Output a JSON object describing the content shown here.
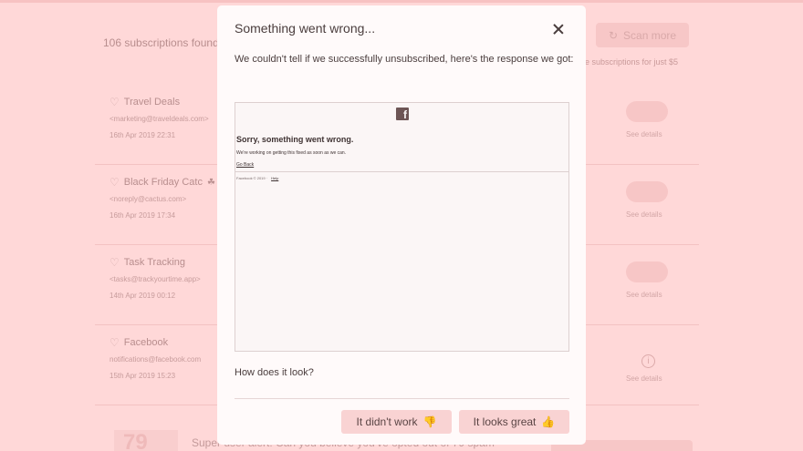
{
  "background": {
    "subscriptions_found": "106 subscriptions found",
    "scan_button": "Scan more",
    "promo_text": "e subscriptions for just $5",
    "see_details": "See details",
    "subscriptions": [
      {
        "name": "Travel Deals",
        "email": "<marketing@traveldeals.com>",
        "date": "16th Apr 2019 22:31"
      },
      {
        "name": "Black Friday Catc",
        "email": "<noreply@cactus.com>",
        "date": "16th Apr 2019 17:34"
      },
      {
        "name": "Task Tracking",
        "email": "<tasks@trackyourtime.app>",
        "date": "14th Apr 2019 00:12"
      },
      {
        "name": "Facebook",
        "email": "notifications@facebook.com",
        "date": "15th Apr 2019 15:23"
      }
    ],
    "footer_number": "79",
    "footer_text": "Super user alert! Can you believe you've opted out of 79 spam"
  },
  "modal": {
    "title": "Something went wrong...",
    "message": "We couldn't tell if we successfully unsubscribed, here's the response we got:",
    "response": {
      "logo_letter": "f",
      "heading": "Sorry, something went wrong.",
      "text": "We're working on getting this fixed as soon as we can.",
      "link": "Go Back",
      "footer": "Facebook © 2019 ·",
      "footer_link": "Help"
    },
    "question": "How does it look?",
    "fail_button": "It didn't work",
    "success_button": "It looks great",
    "colors": {
      "overlay": "#ffd8d8",
      "button": "#f9d3d3",
      "text": "#4a3d3d"
    }
  }
}
